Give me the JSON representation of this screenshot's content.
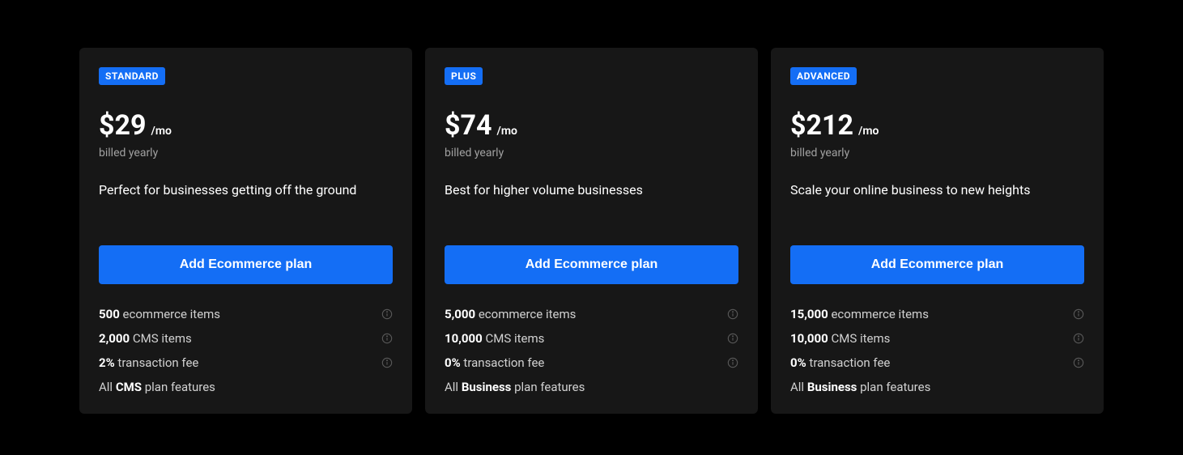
{
  "plans": [
    {
      "badge": "STANDARD",
      "price": "$29",
      "price_suffix": "/mo",
      "billing": "billed yearly",
      "description": "Perfect for businesses getting off the ground",
      "button_label": "Add Ecommerce plan",
      "features": [
        {
          "bold": "500",
          "rest": " ecommerce items",
          "has_info": true
        },
        {
          "bold": "2,000",
          "rest": " CMS items",
          "has_info": true
        },
        {
          "bold": "2%",
          "rest": " transaction fee",
          "has_info": true
        },
        {
          "prefix": "All ",
          "bold": "CMS",
          "rest": " plan features",
          "has_info": false
        }
      ]
    },
    {
      "badge": "PLUS",
      "price": "$74",
      "price_suffix": "/mo",
      "billing": "billed yearly",
      "description": "Best for higher volume businesses",
      "button_label": "Add Ecommerce plan",
      "features": [
        {
          "bold": "5,000",
          "rest": " ecommerce items",
          "has_info": true
        },
        {
          "bold": "10,000",
          "rest": " CMS items",
          "has_info": true
        },
        {
          "bold": "0%",
          "rest": " transaction fee",
          "has_info": true
        },
        {
          "prefix": "All ",
          "bold": "Business",
          "rest": " plan features",
          "has_info": false
        }
      ]
    },
    {
      "badge": "ADVANCED",
      "price": "$212",
      "price_suffix": "/mo",
      "billing": "billed yearly",
      "description": "Scale your online business to new heights",
      "button_label": "Add Ecommerce plan",
      "features": [
        {
          "bold": "15,000",
          "rest": " ecommerce items",
          "has_info": true
        },
        {
          "bold": "10,000",
          "rest": " CMS items",
          "has_info": true
        },
        {
          "bold": "0%",
          "rest": " transaction fee",
          "has_info": true
        },
        {
          "prefix": "All ",
          "bold": "Business",
          "rest": " plan features",
          "has_info": false
        }
      ]
    }
  ]
}
